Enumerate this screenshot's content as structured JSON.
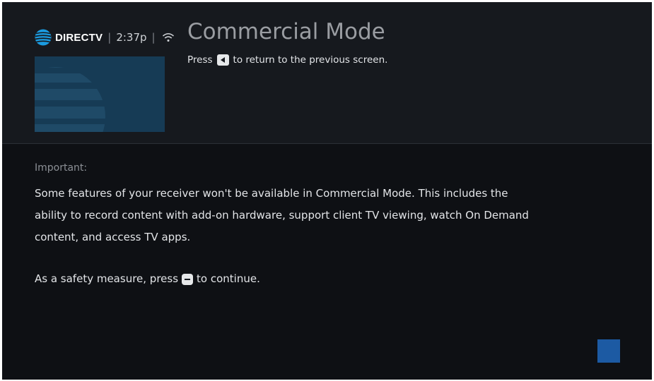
{
  "header": {
    "brand": "DIRECTV",
    "separator": "|",
    "clock": "2:37p",
    "title": "Commercial Mode",
    "hint_before": "Press",
    "hint_after": "to return to the previous screen."
  },
  "body": {
    "label": "Important:",
    "paragraph": "Some features of your receiver won't be available in Commercial Mode. This includes the ability to record content with add-on hardware, support client TV viewing, watch On Demand content, and access TV apps.",
    "safety_before": "As a safety measure, press",
    "safety_after": "to continue."
  },
  "icons": {
    "brand_logo": "att-globe-icon",
    "signal": "wifi-icon",
    "back_key": "back-key-icon",
    "dash_key": "dash-key-icon"
  },
  "colors": {
    "background": "#0e1014",
    "header": "#16191e",
    "accent_blue": "#1c5aa3",
    "preview": "#163b55",
    "globe": "#1b9be0"
  }
}
